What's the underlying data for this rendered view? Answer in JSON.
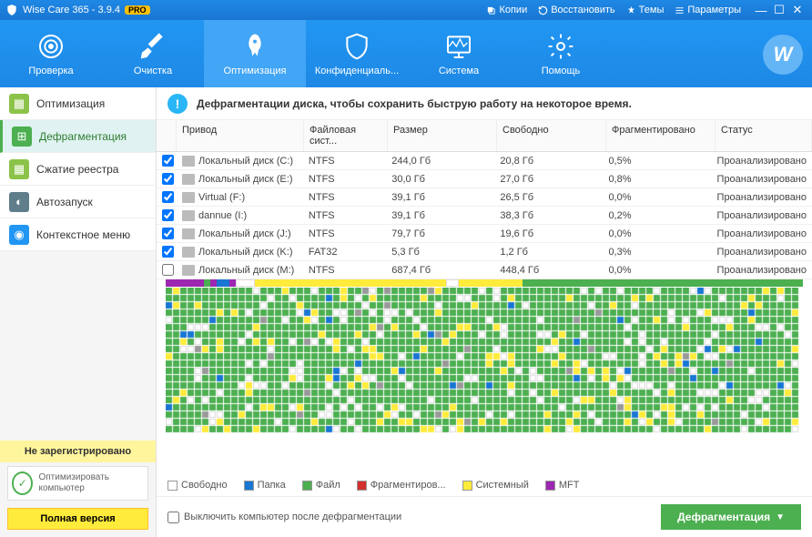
{
  "app": {
    "title": "Wise Care 365 - 3.9.4",
    "pro": "PRO"
  },
  "titlebar_links": [
    "Копии",
    "Восстановить",
    "Темы",
    "Параметры"
  ],
  "toolbar": [
    {
      "label": "Проверка"
    },
    {
      "label": "Очистка"
    },
    {
      "label": "Оптимизация"
    },
    {
      "label": "Конфиденциаль..."
    },
    {
      "label": "Система"
    },
    {
      "label": "Помощь"
    }
  ],
  "sidebar": [
    {
      "label": "Оптимизация",
      "color": "#8bc34a"
    },
    {
      "label": "Дефрагментация",
      "color": "#4caf50"
    },
    {
      "label": "Сжатие реестра",
      "color": "#8bc34a"
    },
    {
      "label": "Автозапуск",
      "color": "#607d8b"
    },
    {
      "label": "Контекстное меню",
      "color": "#2196f3"
    }
  ],
  "unreg": "Не зарегистрировано",
  "optbox": "Оптимизировать компьютер",
  "fullver": "Полная версия",
  "info": "Дефрагментации диска, чтобы сохранить быструю работу на некоторое время.",
  "columns": {
    "drive": "Привод",
    "fs": "Файловая сист...",
    "size": "Размер",
    "free": "Свободно",
    "frag": "Фрагментировано",
    "status": "Статус"
  },
  "rows": [
    {
      "chk": true,
      "name": "Локальный диск (C:)",
      "fs": "NTFS",
      "size": "244,0 Гб",
      "free": "20,8 Гб",
      "frag": "0,5%",
      "status": "Проанализировано"
    },
    {
      "chk": true,
      "name": "Локальный диск (E:)",
      "fs": "NTFS",
      "size": "30,0 Гб",
      "free": "27,0 Гб",
      "frag": "0,8%",
      "status": "Проанализировано"
    },
    {
      "chk": true,
      "name": "Virtual (F:)",
      "fs": "NTFS",
      "size": "39,1 Гб",
      "free": "26,5 Гб",
      "frag": "0,0%",
      "status": "Проанализировано"
    },
    {
      "chk": true,
      "name": "dannue (I:)",
      "fs": "NTFS",
      "size": "39,1 Гб",
      "free": "38,3 Гб",
      "frag": "0,2%",
      "status": "Проанализировано"
    },
    {
      "chk": true,
      "name": "Локальный диск (J:)",
      "fs": "NTFS",
      "size": "79,7 Гб",
      "free": "19,6 Гб",
      "frag": "0,0%",
      "status": "Проанализировано"
    },
    {
      "chk": true,
      "name": "Локальный диск (K:)",
      "fs": "FAT32",
      "size": "5,3 Гб",
      "free": "1,2 Гб",
      "frag": "0,3%",
      "status": "Проанализировано"
    },
    {
      "chk": false,
      "name": "Локальный диск (M:)",
      "fs": "NTFS",
      "size": "687,4 Гб",
      "free": "448,4 Гб",
      "frag": "0,0%",
      "status": "Проанализировано"
    }
  ],
  "legend": [
    {
      "label": "Свободно",
      "color": "#ffffff"
    },
    {
      "label": "Папка",
      "color": "#1976d2"
    },
    {
      "label": "Файл",
      "color": "#4caf50"
    },
    {
      "label": "Фрагментиров...",
      "color": "#d32f2f"
    },
    {
      "label": "Системный",
      "color": "#ffeb3b"
    },
    {
      "label": "MFT",
      "color": "#9c27b0"
    }
  ],
  "footer": {
    "checkbox": "Выключить компьютер после дефрагментации",
    "button": "Дефрагментация"
  },
  "avatar": "W"
}
